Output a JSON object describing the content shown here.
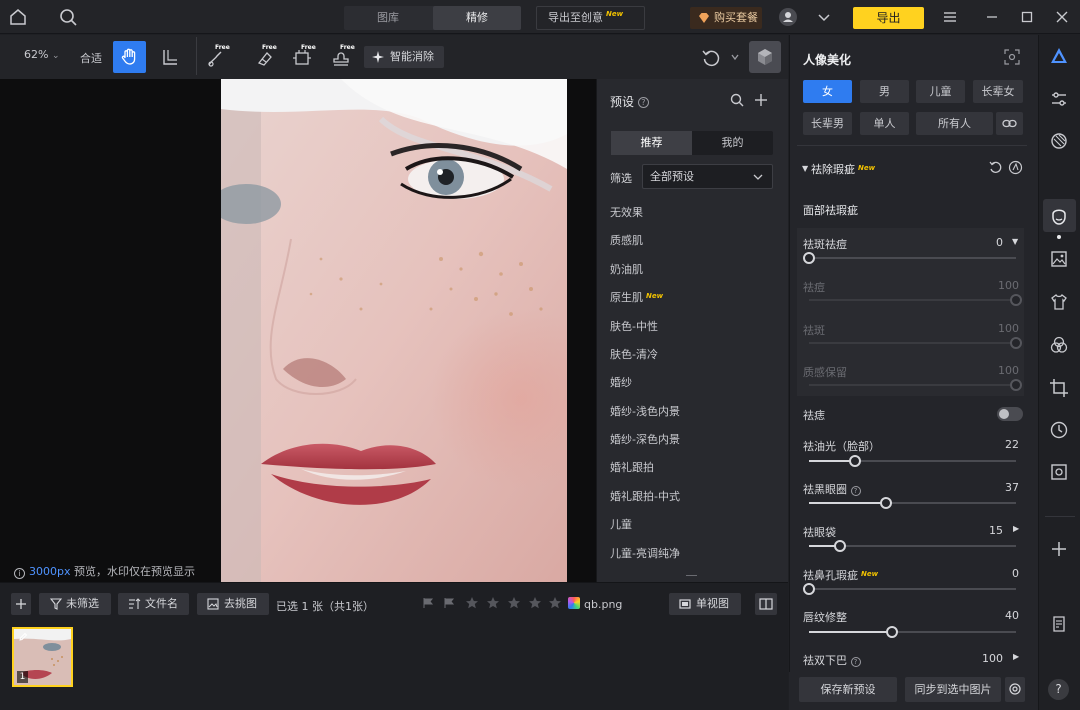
{
  "topbar": {
    "tabs": [
      {
        "label": "图库"
      },
      {
        "label": "精修"
      }
    ],
    "export_creative": "导出至创意",
    "new_badge": "New",
    "buy": "购买套餐",
    "export": "导出"
  },
  "toolbar": {
    "zoom": "62%",
    "fit": "合适",
    "free_label": "Free",
    "smart_erase": "智能消除"
  },
  "canvas": {
    "preview_px": "3000px",
    "preview_note": " 预览，水印仅在预览显示"
  },
  "presets": {
    "title": "预设",
    "tabs": [
      {
        "label": "推荐"
      },
      {
        "label": "我的"
      }
    ],
    "filter_label": "筛选",
    "filter_value": "全部预设",
    "items": [
      {
        "label": "无效果"
      },
      {
        "label": "质感肌"
      },
      {
        "label": "奶油肌"
      },
      {
        "label": "原生肌"
      },
      {
        "label": "肤色-中性"
      },
      {
        "label": "肤色-清冷"
      },
      {
        "label": "婚纱"
      },
      {
        "label": "婚纱-浅色内景"
      },
      {
        "label": "婚纱-深色内景"
      },
      {
        "label": "婚礼跟拍"
      },
      {
        "label": "婚礼跟拍-中式"
      },
      {
        "label": "儿童"
      },
      {
        "label": "儿童-亮调纯净"
      }
    ]
  },
  "bottom": {
    "unfiltered": "未筛选",
    "filename_sort": "文件名",
    "pick": "去挑图",
    "selected": "已选 1 张（共1张）",
    "filename": "qb.png",
    "single_view": "单视图",
    "thumb_index": "1"
  },
  "beauty": {
    "title": "人像美化",
    "chips": [
      {
        "label": "女"
      },
      {
        "label": "男"
      },
      {
        "label": "儿童"
      },
      {
        "label": "长辈女"
      },
      {
        "label": "长辈男"
      },
      {
        "label": "单人"
      },
      {
        "label": "所有人"
      }
    ],
    "section_title": "祛除瑕疵",
    "face_sub": "面部祛瑕疵",
    "sliders": {
      "spot_acne": {
        "label": "祛斑祛痘",
        "value": "0"
      },
      "acne": {
        "label": "祛痘",
        "value": "100"
      },
      "spot": {
        "label": "祛斑",
        "value": "100"
      },
      "texture": {
        "label": "质感保留",
        "value": "100"
      },
      "mole": {
        "label": "祛痣"
      },
      "oil": {
        "label": "祛油光（脸部）",
        "value": "22"
      },
      "dark_circle": {
        "label": "祛黑眼圈",
        "value": "37"
      },
      "eye_bag": {
        "label": "祛眼袋",
        "value": "15"
      },
      "pore": {
        "label": "祛鼻孔瑕疵",
        "value": "0"
      },
      "lip": {
        "label": "唇纹修整",
        "value": "40"
      },
      "chin": {
        "label": "祛双下巴",
        "value": "100"
      }
    },
    "save_preset": "保存新预设",
    "sync": "同步到选中图片"
  },
  "colors": {
    "accent": "#2f7cf0",
    "export": "#ffd21f",
    "new": "#f2c200"
  }
}
